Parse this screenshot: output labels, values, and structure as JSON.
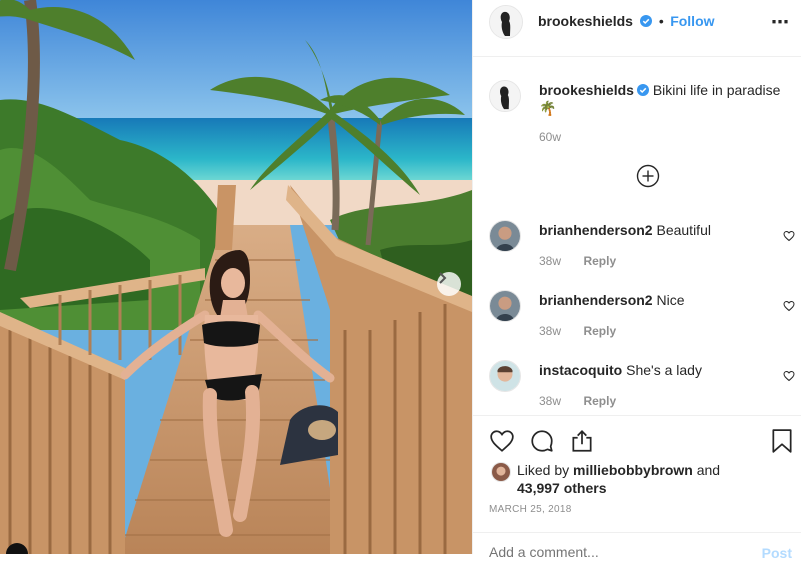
{
  "post": {
    "username": "brookeshields",
    "follow_separator": "•",
    "follow_label": "Follow",
    "more_label": "⋯"
  },
  "caption": {
    "username": "brookeshields",
    "text": "Bikini life in paradise",
    "emoji": "🌴",
    "time": "60w"
  },
  "comments": [
    {
      "username": "brianhenderson2",
      "text": "Beautiful",
      "time": "38w",
      "reply_label": "Reply"
    },
    {
      "username": "brianhenderson2",
      "text": "Nice",
      "time": "38w",
      "reply_label": "Reply"
    },
    {
      "username": "instacoquito",
      "text": "She's a lady",
      "time": "38w",
      "reply_label": "Reply"
    }
  ],
  "likes": {
    "prefix": "Liked by",
    "liker": "milliebobbybrown",
    "and": "and",
    "count": "43,997 others"
  },
  "date": "MARCH 25, 2018",
  "add_comment": {
    "placeholder": "Add a comment...",
    "post_label": "Post"
  },
  "colors": {
    "accent": "#3897f0",
    "verified": "#3897f0",
    "muted": "#8e8e8e",
    "border": "#efefef"
  },
  "icons": [
    "verified-badge-icon",
    "more-icon",
    "load-more-comments-icon",
    "heart-icon",
    "comment-icon",
    "share-icon",
    "bookmark-icon",
    "chevron-right-icon"
  ]
}
